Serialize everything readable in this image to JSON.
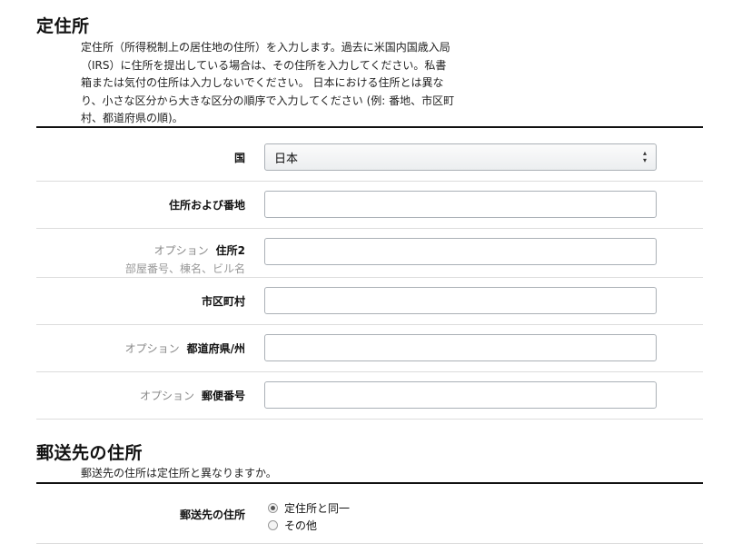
{
  "residence": {
    "title": "定住所",
    "description": [
      "定住所（所得税制上の居住地の住所）を入力します。過去に米国内国歳入局",
      "（IRS）に住所を提出している場合は、その住所を入力してください。私書",
      "箱または気付の住所は入力しないでください。 日本における住所とは異な",
      "り、小さな区分から大きな区分の順序で入力してください (例: 番地、市区町",
      "村、都道府県の順)。"
    ],
    "fields": {
      "country": {
        "label": "国",
        "value": "日本"
      },
      "address1": {
        "label": "住所および番地",
        "value": ""
      },
      "address2": {
        "optional": "オプション",
        "label": "住所2",
        "hint": "部屋番号、棟名、ビル名",
        "value": ""
      },
      "city": {
        "label": "市区町村",
        "value": ""
      },
      "prefecture": {
        "optional": "オプション",
        "label": "都道府県/州",
        "value": ""
      },
      "postal": {
        "optional": "オプション",
        "label": "郵便番号",
        "value": ""
      }
    }
  },
  "mailing": {
    "title": "郵送先の住所",
    "description": "郵送先の住所は定住所と異なりますか。",
    "field_label": "郵送先の住所",
    "options": [
      {
        "label": "定住所と同一",
        "checked": true
      },
      {
        "label": "その他",
        "checked": false
      }
    ]
  }
}
